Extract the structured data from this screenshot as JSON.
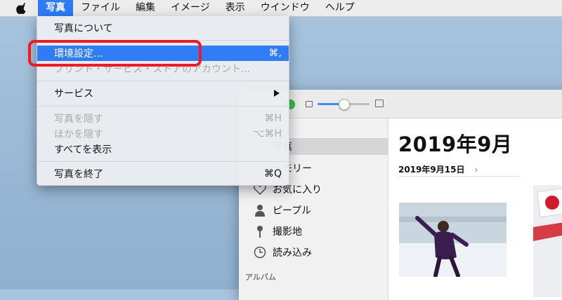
{
  "menubar": {
    "items": [
      "写真",
      "ファイル",
      "編集",
      "イメージ",
      "表示",
      "ウインドウ",
      "ヘルプ"
    ],
    "active_index": 0
  },
  "menu": {
    "about": "写真について",
    "preferences": "環境設定...",
    "preferences_shortcut": "⌘,",
    "store_account": "プリント・サービス・ストアのアカウント...",
    "services": "サービス",
    "hide": "写真を隠す",
    "hide_shortcut": "⌘H",
    "hide_others": "ほかを隠す",
    "hide_others_shortcut": "⌥⌘H",
    "show_all": "すべてを表示",
    "quit": "写真を終了",
    "quit_shortcut": "⌘Q"
  },
  "sidebar": {
    "items": [
      {
        "label": "写真",
        "icon": "photos-icon"
      },
      {
        "label": "メモリー",
        "icon": "memories-icon"
      },
      {
        "label": "お気に入り",
        "icon": "heart-icon"
      },
      {
        "label": "ピープル",
        "icon": "person-icon"
      },
      {
        "label": "撮影地",
        "icon": "pin-icon"
      },
      {
        "label": "読み込み",
        "icon": "clock-icon"
      }
    ],
    "albums_header": "アルバム"
  },
  "content": {
    "title": "2019年9月",
    "date": "2019年9月15日",
    "chevron": "›"
  },
  "zoom_slider": {
    "value": 0.5
  },
  "colors": {
    "menu_highlight": "#2f7cf6",
    "annotation_red": "#ee1b24"
  }
}
